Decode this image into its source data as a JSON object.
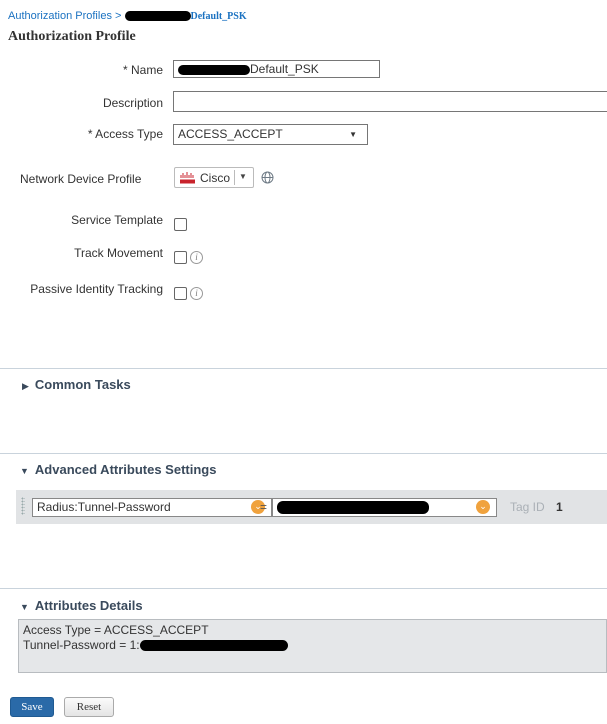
{
  "breadcrumb": {
    "parent": "Authorization Profiles",
    "separator": ">",
    "current_suffix": "Default_PSK"
  },
  "page_title": "Authorization Profile",
  "form": {
    "name_label": "* Name",
    "name_value_suffix": "Default_PSK",
    "description_label": "Description",
    "description_value": "",
    "access_type_label": "* Access Type",
    "access_type_value": "ACCESS_ACCEPT",
    "network_device_profile_label": "Network Device Profile",
    "network_device_profile_value": "Cisco",
    "service_template_label": "Service Template",
    "track_movement_label": "Track Movement",
    "passive_identity_label": "Passive Identity Tracking",
    "service_template_checked": false,
    "track_movement_checked": false,
    "passive_identity_checked": false
  },
  "sections": {
    "common_tasks": "Common Tasks",
    "advanced_attributes": "Advanced Attributes Settings",
    "attributes_details": "Attributes Details"
  },
  "advanced": {
    "attribute_name": "Radius:Tunnel-Password",
    "operator": "=",
    "tag_label": "Tag ID",
    "tag_value": "1"
  },
  "details": {
    "line1": "Access Type = ACCESS_ACCEPT",
    "line2_prefix": "Tunnel-Password = 1:"
  },
  "buttons": {
    "save": "Save",
    "reset": "Reset"
  },
  "colors": {
    "link": "#1b72c1",
    "save_button": "#2a6aa8",
    "accent_orange": "#f0a23d",
    "section_text": "#3a4a5c"
  },
  "icons": [
    "info-icon",
    "globe-icon",
    "cisco-logo-icon",
    "chevron-down-icon",
    "triangle-right-icon",
    "triangle-down-icon"
  ]
}
